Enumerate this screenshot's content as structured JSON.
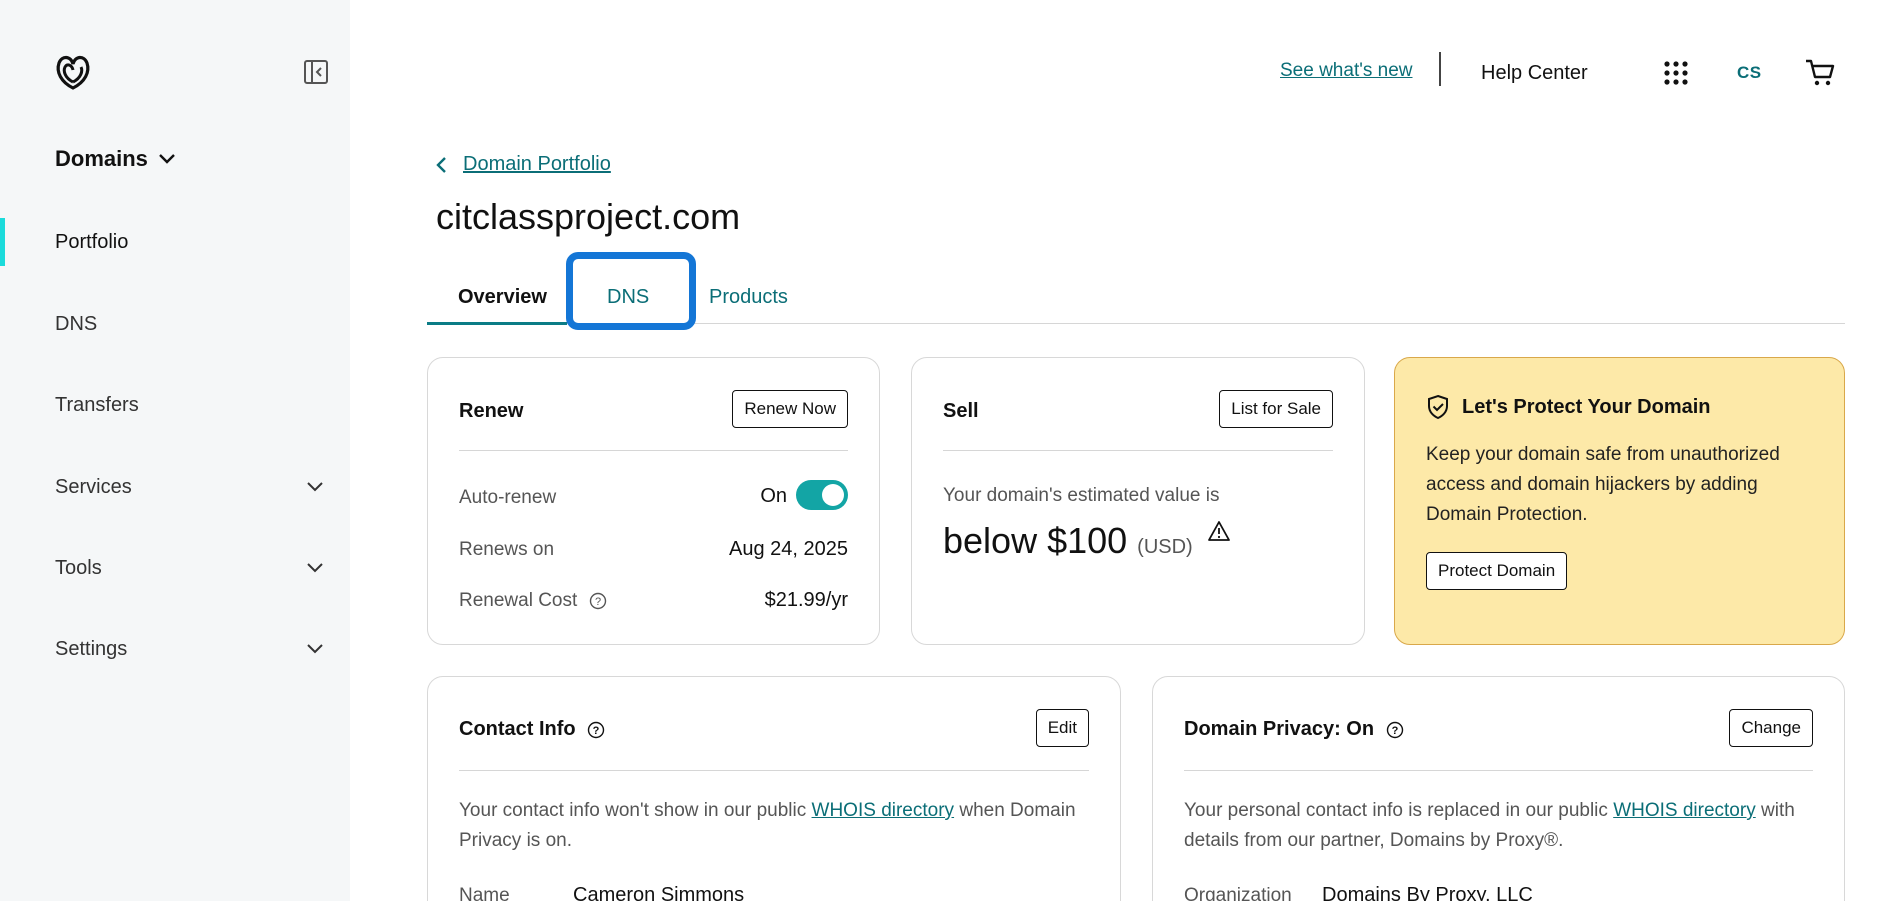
{
  "sidebar": {
    "section_title": "Domains",
    "items": [
      {
        "label": "Portfolio"
      },
      {
        "label": "DNS"
      },
      {
        "label": "Transfers"
      },
      {
        "label": "Services"
      },
      {
        "label": "Tools"
      },
      {
        "label": "Settings"
      }
    ]
  },
  "header": {
    "whats_new": "See what's new",
    "help_center": "Help Center",
    "initials": "CS"
  },
  "breadcrumb": {
    "label": "Domain Portfolio"
  },
  "page_title": "citclassproject.com",
  "tabs": [
    {
      "label": "Overview"
    },
    {
      "label": "DNS"
    },
    {
      "label": "Products"
    }
  ],
  "renew_card": {
    "title": "Renew",
    "button": "Renew Now",
    "auto_renew_label": "Auto-renew",
    "auto_renew_state": "On",
    "renews_on_label": "Renews on",
    "renews_on_value": "Aug 24, 2025",
    "cost_label": "Renewal Cost",
    "cost_value": "$21.99/yr"
  },
  "sell_card": {
    "title": "Sell",
    "button": "List for Sale",
    "estimate_text": "Your domain's estimated value is",
    "estimate_value": "below $100",
    "currency": "(USD)"
  },
  "protect_card": {
    "title": "Let's Protect Your Domain",
    "body": "Keep your domain safe from unauthorized access and domain hijackers by adding Domain Protection.",
    "button": "Protect Domain"
  },
  "contact_card": {
    "title": "Contact Info",
    "button": "Edit",
    "text_before": "Your contact info won't show in our public",
    "link": "WHOIS directory",
    "text_after": "when Domain Privacy is on.",
    "name_label": "Name",
    "name_value": "Cameron Simmons"
  },
  "privacy_card": {
    "title": "Domain Privacy: On",
    "button": "Change",
    "text_before": "Your personal contact info is replaced in our public",
    "link": "WHOIS directory",
    "text_after": "with details from our partner, Domains by Proxy®.",
    "org_label": "Organization",
    "org_value": "Domains By Proxy, LLC"
  },
  "colors": {
    "accent": "#0b6e77",
    "toggle": "#13a5a5",
    "highlight": "#1476d6",
    "protect_bg": "#fde9a8"
  }
}
